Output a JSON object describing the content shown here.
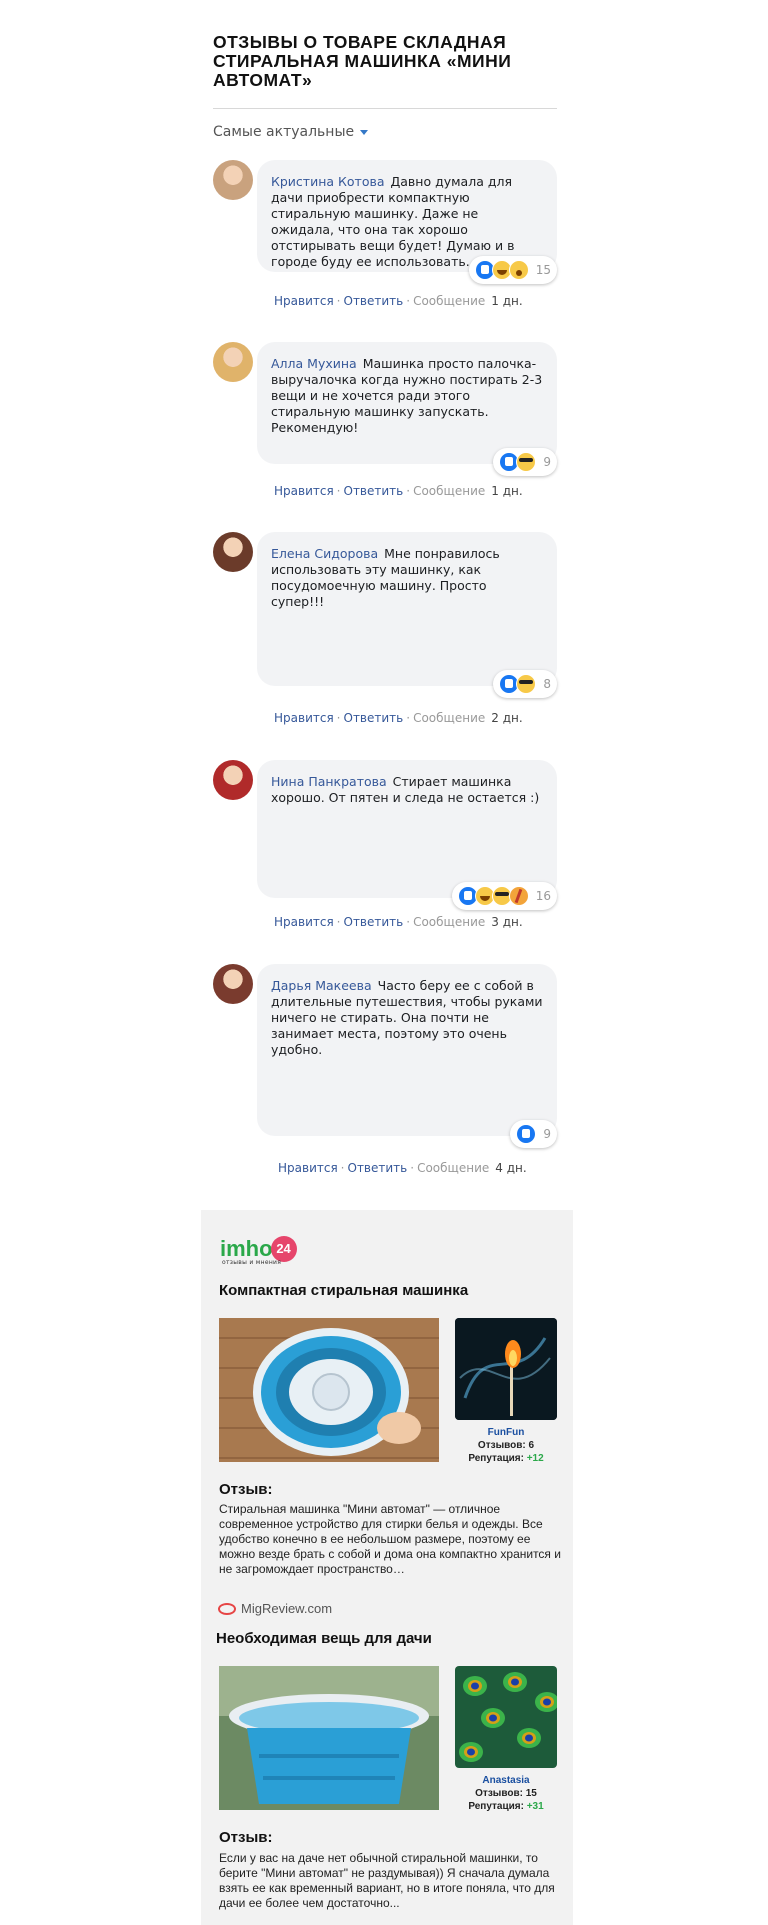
{
  "page_title": "ОТЗЫВЫ О ТОВАРЕ СКЛАДНАЯ СТИРАЛЬНАЯ МАШИНКА «МИНИ АВТОМАТ»",
  "sort": {
    "label": "Самые актуальные"
  },
  "action_labels": {
    "like": "Нравится",
    "reply": "Ответить",
    "message": "Сообщение",
    "dot": "·"
  },
  "comments": [
    {
      "author": "Кристина Котова",
      "text": "Давно думала для дачи приобрести компактную стиральную машинку. Даже не ожидала, что она так хорошо отстирывать вещи будет! Думаю и в городе буду ее использовать.",
      "reactions": [
        "like-icon",
        "haha-icon",
        "wow-icon"
      ],
      "count": "15",
      "time": "1 дн.",
      "avatar_color": "#c9a27e"
    },
    {
      "author": "Алла Мухина",
      "text": "Машинка просто палочка-выручалочка когда нужно постирать 2-3 вещи и не хочется ради этого стиральную машинку запускать. Рекомендую!",
      "reactions": [
        "like-icon",
        "cool-icon"
      ],
      "count": "9",
      "time": "1 дн.",
      "avatar_color": "#e0b36a"
    },
    {
      "author": "Елена Сидорова",
      "text": "Мне понравилось использовать эту машинку, как посудомоечную машину. Просто супер!!!",
      "reactions": [
        "like-icon",
        "cool-icon"
      ],
      "count": "8",
      "time": "2 дн.",
      "avatar_color": "#6b3b2a"
    },
    {
      "author": "Нина Панкратова",
      "text": "Стирает машинка хорошо. От пятен и следа не остается :)",
      "reactions": [
        "like-icon",
        "haha-icon",
        "cool-icon",
        "party-icon"
      ],
      "count": "16",
      "time": "3 дн.",
      "avatar_color": "#b02a2a"
    },
    {
      "author": "Дарья Макеева",
      "text": "Часто беру ее с собой в длительные путешествия, чтобы руками ничего не стирать. Она почти не занимает места, поэтому это очень удобно.",
      "reactions": [
        "like-icon"
      ],
      "count": "9",
      "time": "4 дн.",
      "avatar_color": "#7a3b2e"
    }
  ],
  "promo": {
    "logo_text": "imho",
    "logo_badge": "24",
    "logo_sub": "отзывы и мнения",
    "reviews": [
      {
        "title": "Компактная стиральная машинка",
        "user": "FunFun",
        "reviews_label": "Отзывов:",
        "reviews_count": "6",
        "rep_label": "Репутация:",
        "rep_value": "+12",
        "heading": "Отзыв:",
        "text": "Стиральная машинка \"Мини автомат\" — отличное современное устройство для стирки белья и одежды. Все удобство конечно в ее небольшом размере, поэтому ее можно везде брать с собой и дома она компактно хранится и не загромождает пространство…"
      },
      {
        "title": "Необходимая вещь для дачи",
        "user": "Anastasia",
        "reviews_label": "Отзывов:",
        "reviews_count": "15",
        "rep_label": "Репутация:",
        "rep_value": "+31",
        "heading": "Отзыв:",
        "text": "Если у вас на даче нет обычной стиральной машинки, то берите \"Мини автомат\" не раздумывая)) Я сначала думала взять ее как временный вариант, но в итоге поняла, что для дачи ее более чем достаточно..."
      }
    ],
    "source": "MigReview.com"
  }
}
